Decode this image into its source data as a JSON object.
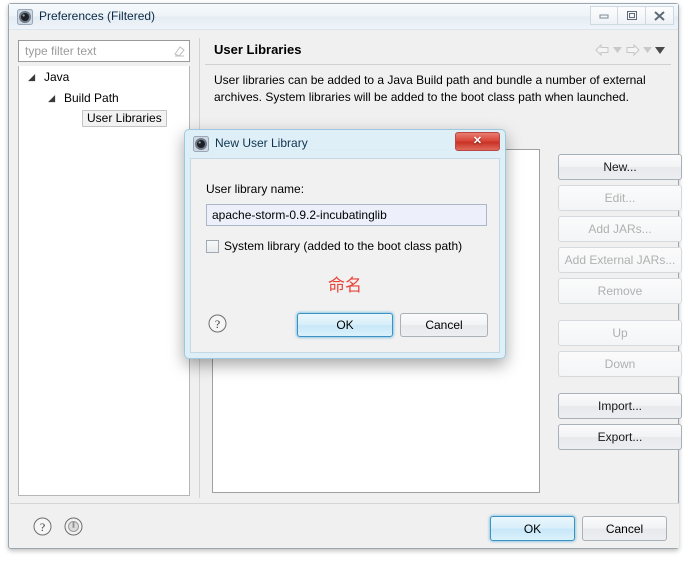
{
  "window": {
    "title": "Preferences (Filtered)",
    "app_icon": "eclipse-icon",
    "controls": {
      "minimize": "minimize-icon",
      "maximize": "maximize-icon",
      "close": "close-icon"
    }
  },
  "filter": {
    "placeholder": "type filter text",
    "value": "",
    "clear_icon": "eraser-icon"
  },
  "tree": {
    "items": [
      {
        "label": "Java",
        "level": 0,
        "expanded": true,
        "selected": false
      },
      {
        "label": "Build Path",
        "level": 1,
        "expanded": true,
        "selected": false
      },
      {
        "label": "User Libraries",
        "level": 2,
        "expanded": false,
        "selected": true
      }
    ]
  },
  "content": {
    "title": "User Libraries",
    "description": "User libraries can be added to a Java Build path and bundle a number of external archives. System libraries will be added to the boot class path when launched.",
    "nav": {
      "back_icon": "arrow-left-icon",
      "back_menu_icon": "chevron-down-icon",
      "forward_icon": "arrow-right-icon",
      "forward_menu_icon": "chevron-down-icon",
      "view_menu_icon": "chevron-down-icon"
    },
    "list_items": []
  },
  "side_buttons": [
    {
      "label": "New...",
      "enabled": true,
      "gap": false
    },
    {
      "label": "Edit...",
      "enabled": false,
      "gap": false
    },
    {
      "label": "Add JARs...",
      "enabled": false,
      "gap": false
    },
    {
      "label": "Add External JARs...",
      "enabled": false,
      "gap": false
    },
    {
      "label": "Remove",
      "enabled": false,
      "gap": false
    },
    {
      "label": "Up",
      "enabled": false,
      "gap": true
    },
    {
      "label": "Down",
      "enabled": false,
      "gap": false
    },
    {
      "label": "Import...",
      "enabled": true,
      "gap": true
    },
    {
      "label": "Export...",
      "enabled": true,
      "gap": false
    }
  ],
  "bottom_bar": {
    "help_icon": "help-circle-icon",
    "second_icon": "apply-circle-icon",
    "ok_label": "OK",
    "cancel_label": "Cancel"
  },
  "dialog": {
    "title": "New User Library",
    "icon": "eclipse-icon",
    "close_glyph": "✕",
    "name_label": "User library name:",
    "name_value": "apache-storm-0.9.2-incubatinglib",
    "name_placeholder": "",
    "system_library_label": "System library (added to the boot class path)",
    "system_library_checked": false,
    "help_icon": "help-circle-icon",
    "ok_label": "OK",
    "cancel_label": "Cancel"
  },
  "annotation": {
    "text": "命名",
    "color": "#e8443a"
  },
  "colors": {
    "accent_blue": "#3c93c2",
    "close_red": "#c83224",
    "dialog_border": "#9fc7dd",
    "panel_bg": "#f0f0f0",
    "annotation_red": "#e8443a"
  }
}
